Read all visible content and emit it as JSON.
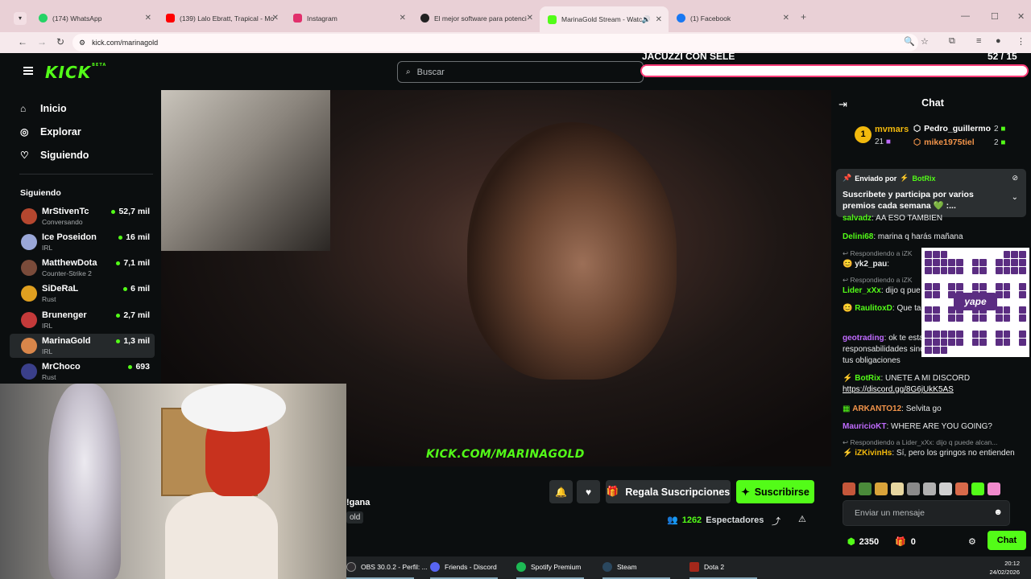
{
  "browser": {
    "tabs": [
      {
        "label": "(174) WhatsApp",
        "color": "#25d366"
      },
      {
        "label": "(139) Lalo Ebratt, Trapical - Mo",
        "color": "#ff0000"
      },
      {
        "label": "Instagram",
        "color": "#e1306c"
      },
      {
        "label": "El mejor software para potenci",
        "color": "#222222"
      },
      {
        "label": "MarinaGold Stream - Watc",
        "color": "#53fc18"
      },
      {
        "label": "(1) Facebook",
        "color": "#1877f2"
      }
    ],
    "new_tab": "+",
    "url": "kick.com/marinagold"
  },
  "header": {
    "logo": "KICK",
    "logo_badge": "BETA",
    "search_placeholder": "Buscar"
  },
  "overlay": {
    "goal_title": "JACUZZI CON SELE",
    "goal_count": "52  / 15",
    "goal_fraction": 1.0
  },
  "sidebar": {
    "nav": [
      {
        "label": "Inicio",
        "icon": "home-icon"
      },
      {
        "label": "Explorar",
        "icon": "compass-icon"
      },
      {
        "label": "Siguiendo",
        "icon": "heart-icon"
      }
    ],
    "following_title": "Siguiendo",
    "channels": [
      {
        "name": "MrStivenTc",
        "category": "Conversando",
        "viewers": "52,7 mil",
        "color": "#b5472f"
      },
      {
        "name": "Ice Poseidon",
        "category": "IRL",
        "viewers": "16 mil",
        "color": "#9aa7d8"
      },
      {
        "name": "MatthewDota",
        "category": "Counter-Strike 2",
        "viewers": "7,1 mil",
        "color": "#7a4b3a"
      },
      {
        "name": "SiDeRaL",
        "category": "Rust",
        "viewers": "6 mil",
        "color": "#e0a020"
      },
      {
        "name": "Brunenger",
        "category": "IRL",
        "viewers": "2,7 mil",
        "color": "#c43a3a"
      },
      {
        "name": "MarinaGold",
        "category": "IRL",
        "viewers": "1,3 mil",
        "color": "#d8864a"
      },
      {
        "name": "MrChoco",
        "category": "Rust",
        "viewers": "693",
        "color": "#3a3f8a"
      }
    ]
  },
  "video": {
    "watermark": "KICK.COM/MARINAGOLD"
  },
  "stream": {
    "title_fragment": "!gana",
    "tag_fragment": "old",
    "gift_label": "Regala Suscripciones",
    "subscribe_label": "Suscribirse",
    "viewer_count": "1262",
    "viewer_label": "Espectadores"
  },
  "taskbar": {
    "items": [
      {
        "label": "OBS 30.0.2 - Perfil: ...",
        "color": "#302e31"
      },
      {
        "label": "Friends - Discord",
        "color": "#5865f2"
      },
      {
        "label": "Spotify Premium",
        "color": "#1db954"
      },
      {
        "label": "Steam",
        "color": "#1b2838"
      },
      {
        "label": "Dota 2",
        "color": "#a4281b"
      }
    ],
    "time": "20:12",
    "date": "24/02/2026"
  },
  "chat": {
    "title": "Chat",
    "leaderboard": {
      "top_rank": "1",
      "top_name": "mvmars",
      "top_count": "21",
      "others": [
        {
          "name": "Pedro_guillermo",
          "count": "2",
          "color": "#ffffff"
        },
        {
          "name": "mike1975tiel",
          "count": "2",
          "color": "#f2944a"
        }
      ]
    },
    "pinned": {
      "sent_by": "Enviado por",
      "bot": "BotRix",
      "text": "Suscribete y participa por varios premios cada semana 💚 :..."
    },
    "messages": [
      {
        "user": "salvadz",
        "text": "AA ESO TAMBIEN",
        "color": "#53fc18"
      },
      {
        "user": "Delini68",
        "text": "marina q harás mañana",
        "color": "#53fc18"
      },
      {
        "reply": "Respondiendo a iZK"
      },
      {
        "user": "yk2_pau",
        "text": "",
        "color": "#ffffff"
      },
      {
        "reply": "Respondiendo a iZK"
      },
      {
        "user": "Lider_xXx",
        "text": "dijo q pue",
        "color": "#53fc18"
      },
      {
        "user": "RaulitoxD",
        "text": "Que ta",
        "color": "#53fc18"
      },
      {
        "user": "geotrading",
        "text": "ok te esta tus responsabilidades sino pues a cumplir con tus obligaciones",
        "color": "#c06bff"
      },
      {
        "user": "BotRix",
        "text": "UNETE A MI DISCORD",
        "link": "https://discord.gg/8G6jUkK5AS",
        "color": "#53fc18"
      },
      {
        "user": "ARKANTO12",
        "text": "Selvita go",
        "color": "#f2944a"
      },
      {
        "user": "MauricioKT",
        "text": "WHERE ARE YOU GOING?",
        "color": "#c06bff"
      },
      {
        "reply": "Respondiendo a Lider_xXx: dijo q puede alcan..."
      },
      {
        "user": "iZKivinHs",
        "text": "Sí, pero los gringos no entienden",
        "color": "#f2b90d"
      }
    ],
    "qr_label": "yape",
    "input_placeholder": "Enviar un mensaje",
    "points": "2350",
    "gifts": "0",
    "chat_button": "Chat"
  }
}
